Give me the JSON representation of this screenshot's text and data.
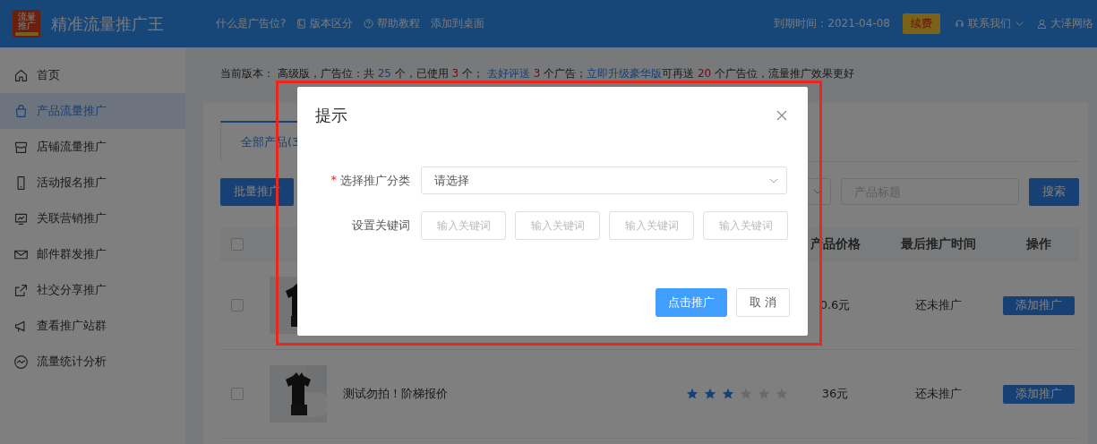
{
  "header": {
    "logo_text": "流量推广",
    "title": "精准流量推广王",
    "links": [
      "什么是广告位?",
      "版本区分",
      "帮助教程",
      "添加到桌面"
    ],
    "expiry": "到期时间：2021-04-08",
    "renew": "续费",
    "contact": "联系我们",
    "user": "大泽网络"
  },
  "sidebar": {
    "items": [
      {
        "label": "首页",
        "selected": false
      },
      {
        "label": "产品流量推广",
        "selected": true
      },
      {
        "label": "店铺流量推广",
        "selected": false
      },
      {
        "label": "活动报名推广",
        "selected": false
      },
      {
        "label": "关联营销推广",
        "selected": false
      },
      {
        "label": "邮件群发推广",
        "selected": false
      },
      {
        "label": "社交分享推广",
        "selected": false
      },
      {
        "label": "查看推广站群",
        "selected": false
      },
      {
        "label": "流量统计分析",
        "selected": false
      }
    ]
  },
  "notice": [
    {
      "kind": "text",
      "text": "当前版本： "
    },
    {
      "kind": "text",
      "text": "高级版，广告位：共 "
    },
    {
      "kind": "count",
      "text": "25"
    },
    {
      "kind": "text",
      "text": " 个，已使用 "
    },
    {
      "kind": "used",
      "text": "3"
    },
    {
      "kind": "text",
      "text": " 个； "
    },
    {
      "kind": "link",
      "text": "去好评送"
    },
    {
      "kind": "used",
      "text": " 3"
    },
    {
      "kind": "text",
      "text": " 个广告；"
    },
    {
      "kind": "link",
      "text": "立即升级豪华版"
    },
    {
      "kind": "text",
      "text": "可再送 "
    },
    {
      "kind": "used",
      "text": "20"
    },
    {
      "kind": "text",
      "text": " 个广告位，流量推广效果更好"
    }
  ],
  "tabs": [
    {
      "label": "全部产品(3",
      "selected": true
    }
  ],
  "toolbar": {
    "batch_button": "批量推广",
    "title_placeholder": "产品标题",
    "search_button": "搜索"
  },
  "table": {
    "header_checked": false,
    "columns": [
      "产品价格",
      "最后推广时间",
      "操作"
    ],
    "rows": [
      {
        "checked": false,
        "price": "0.6元",
        "last_time": "还未推广",
        "action": "添加推广"
      },
      {
        "checked": false,
        "name": "测试勿拍！阶梯报价",
        "stars": 3,
        "price": "36元",
        "last_time": "还未推广",
        "action": "添加推广"
      }
    ]
  },
  "dialog": {
    "title": "提示",
    "category_label": "选择推广分类",
    "required_mark": "*",
    "category_placeholder": "请选择",
    "keyword_label": "设置关键词",
    "keyword_placeholders": [
      "输入关键词",
      "输入关键词",
      "输入关键词",
      "输入关键词"
    ],
    "confirm": "点击推广",
    "cancel": "取 消"
  }
}
